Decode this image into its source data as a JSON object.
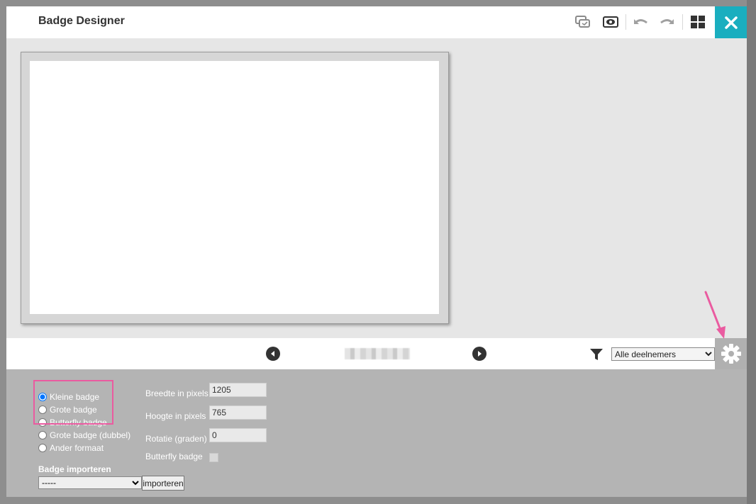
{
  "header": {
    "title": "Badge Designer"
  },
  "toolbar": {
    "icons": [
      "duplicate-icon",
      "preview-eye-icon",
      "undo-icon",
      "redo-icon",
      "layout-grid-icon",
      "close-icon"
    ],
    "close_color": "#1aaebf"
  },
  "navigation": {
    "prev_icon": "chevron-left-icon",
    "next_icon": "chevron-right-icon",
    "filter_icon": "filter-icon",
    "participants_selected": "Alle deelnemers",
    "settings_icon": "gear-icon"
  },
  "settings": {
    "badge_types": [
      {
        "label": "Kleine badge",
        "checked": true
      },
      {
        "label": "Grote badge",
        "checked": false
      },
      {
        "label": "Butterfly badge",
        "checked": false
      },
      {
        "label": "Grote badge (dubbel)",
        "checked": false
      },
      {
        "label": "Ander formaat",
        "checked": false
      }
    ],
    "width_label": "Breedte in pixels",
    "width_value": "1205",
    "height_label": "Hoogte in pixels",
    "height_value": "765",
    "rotation_label": "Rotatie (graden)",
    "rotation_value": "0",
    "butterfly_label": "Butterfly badge",
    "import_title": "Badge importeren",
    "import_selected": "-----",
    "import_button": "importeren"
  },
  "annotation": {
    "highlight_color": "#ea5ba0"
  }
}
